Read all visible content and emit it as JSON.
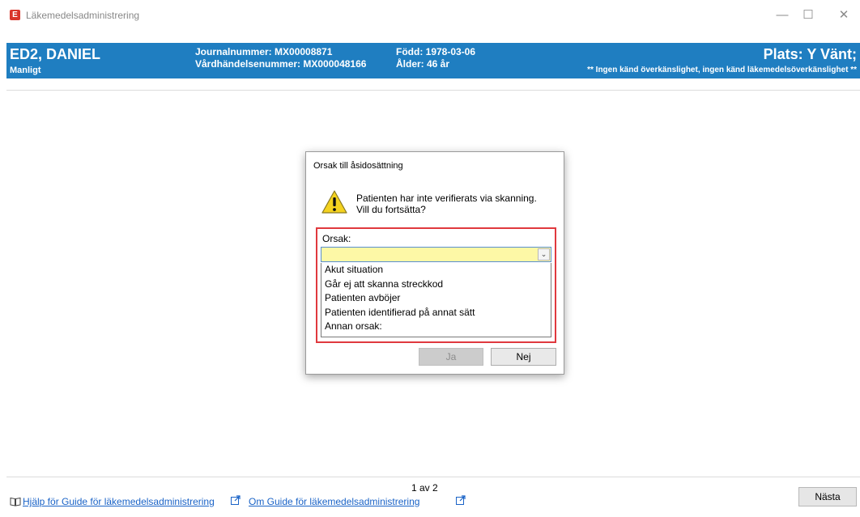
{
  "window": {
    "icon_letter": "E",
    "title": "Läkemedelsadministrering",
    "controls": [
      "—",
      "☐",
      "✕"
    ]
  },
  "patient": {
    "name": "ED2, DANIEL",
    "gender": "Manligt",
    "journal": "Journalnummer: MX00008871",
    "care_event": "Vårdhändelsenummer: MX000048166",
    "born": "Född: 1978-03-06",
    "age": "Ålder: 46 år",
    "place": "Plats: Y Vänt;",
    "allergy": "** Ingen känd överkänslighet, ingen känd läkemedelsöverkänslighet **",
    "header_color": "#1f7ec1"
  },
  "dialog": {
    "title": "Orsak till åsidosättning",
    "icon": "warning-icon",
    "message_line1": "Patienten har inte verifierats via skanning.",
    "message_line2": "Vill du fortsätta?",
    "orsak_label": "Orsak:",
    "orsak_value": "",
    "options": [
      "Akut situation",
      "Går ej att skanna streckkod",
      "Patienten avböjer",
      "Patienten identifierad på annat sätt",
      "Annan orsak:"
    ],
    "yes_label": "Ja",
    "no_label": "Nej",
    "highlight_color": "#e0393e"
  },
  "footer": {
    "pager": "1 av 2",
    "help_link": "Hjälp för Guide för läkemedelsadministrering",
    "about_link": "Om Guide för läkemedelsadministrering",
    "next_label": "Nästa"
  }
}
